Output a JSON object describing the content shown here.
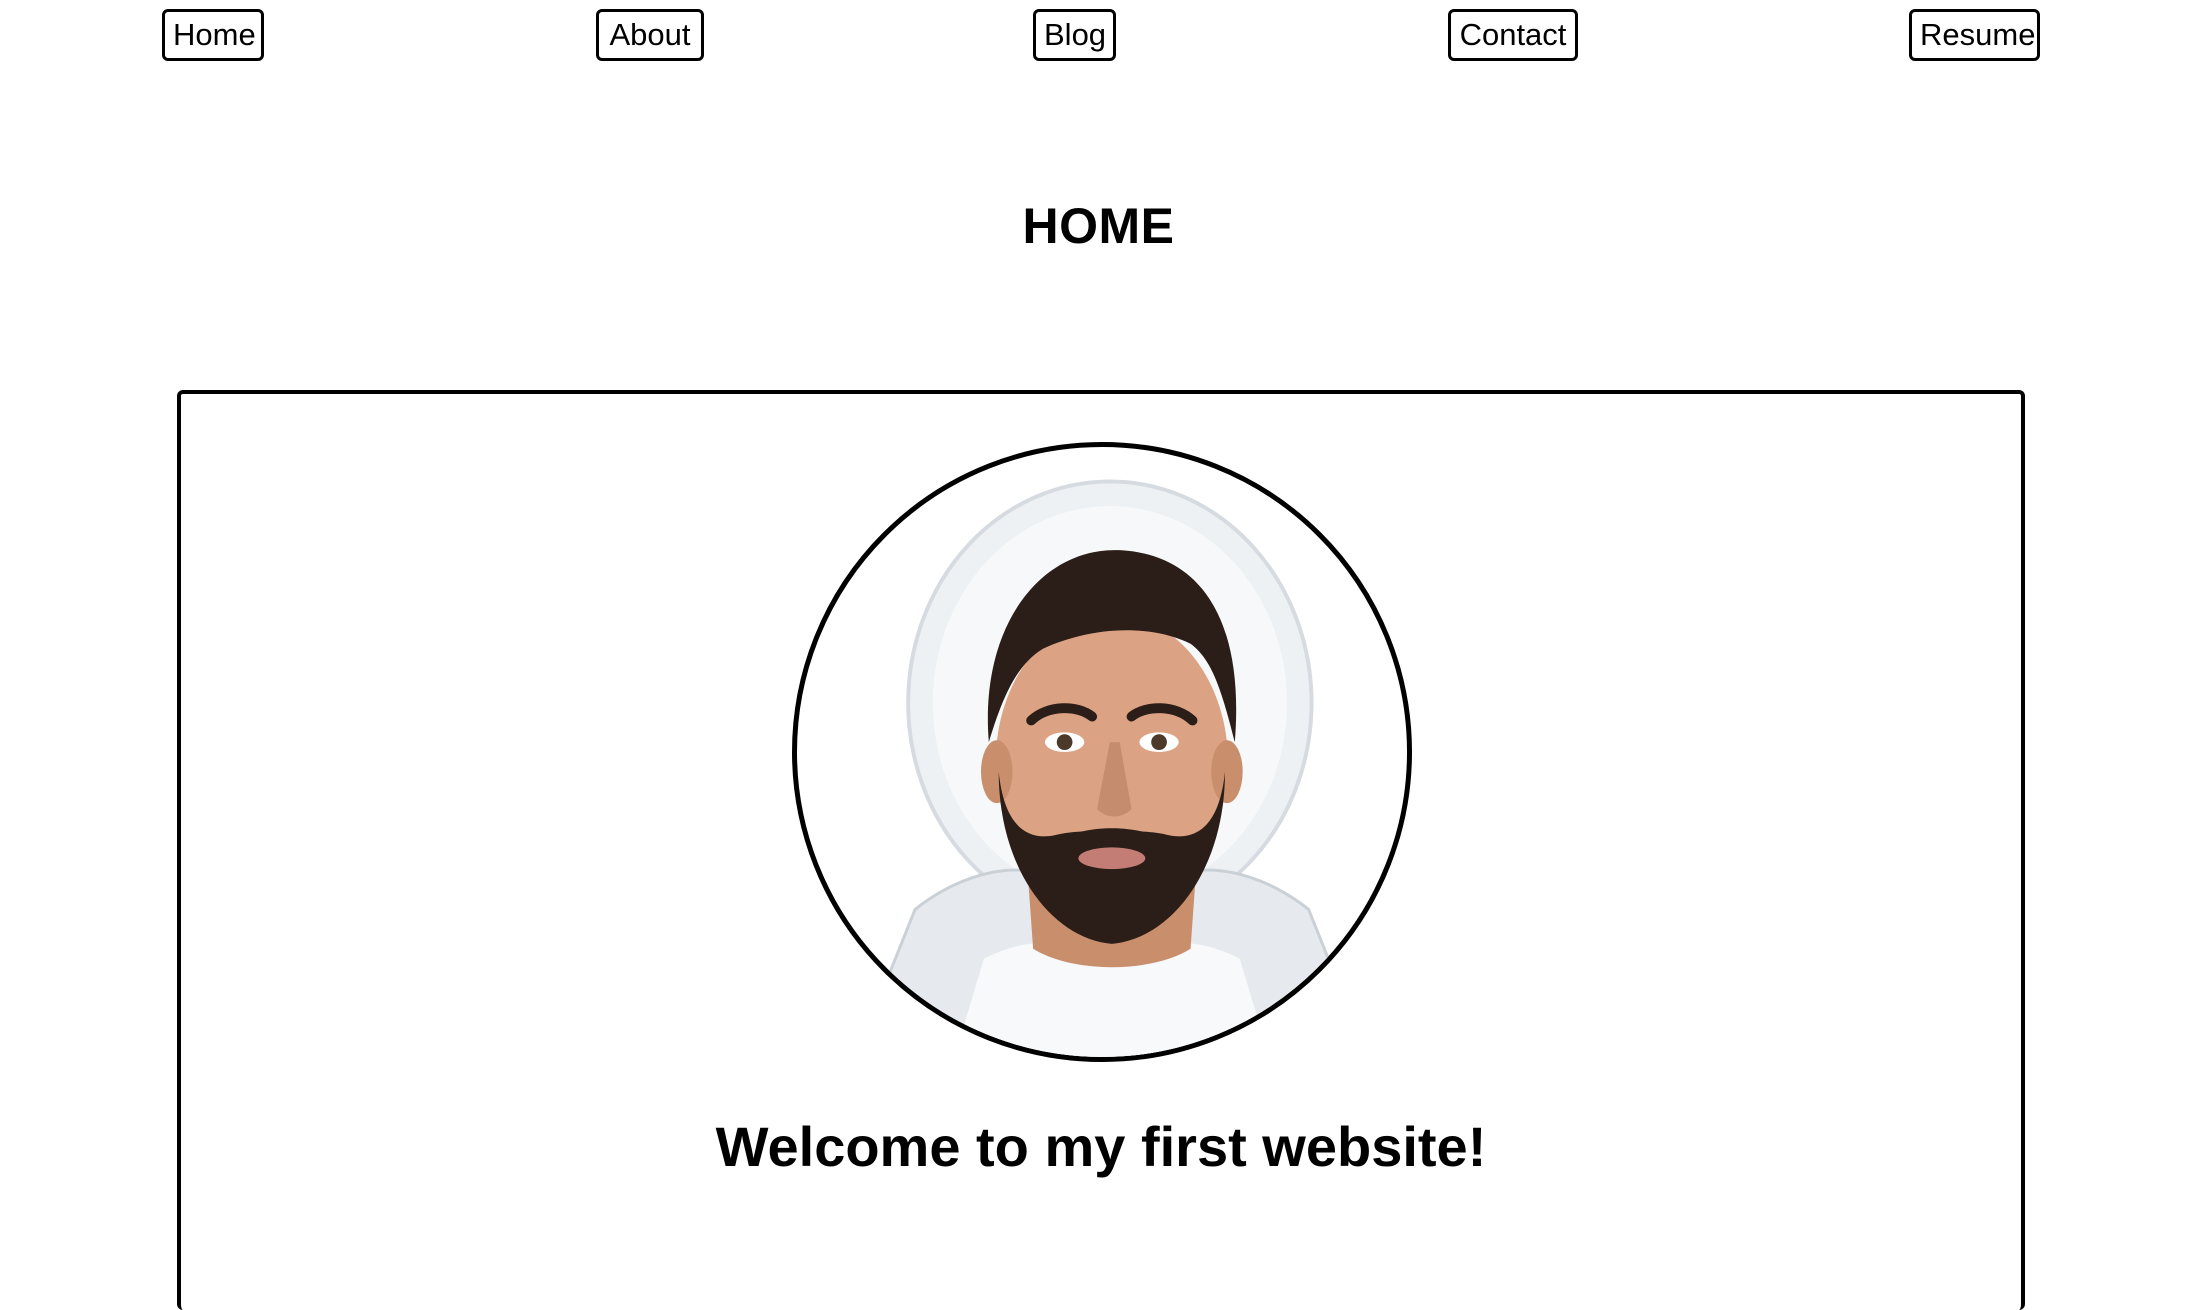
{
  "nav": {
    "home_label": "Home",
    "about_label": "About",
    "blog_label": "Blog",
    "contact_label": "Contact",
    "resume_label": "Resume"
  },
  "page": {
    "title": "HOME"
  },
  "card": {
    "avatar_icon": "profile-portrait",
    "welcome_text": "Welcome to my first website!"
  },
  "colors": {
    "border": "#000000",
    "background": "#ffffff",
    "text": "#000000"
  }
}
